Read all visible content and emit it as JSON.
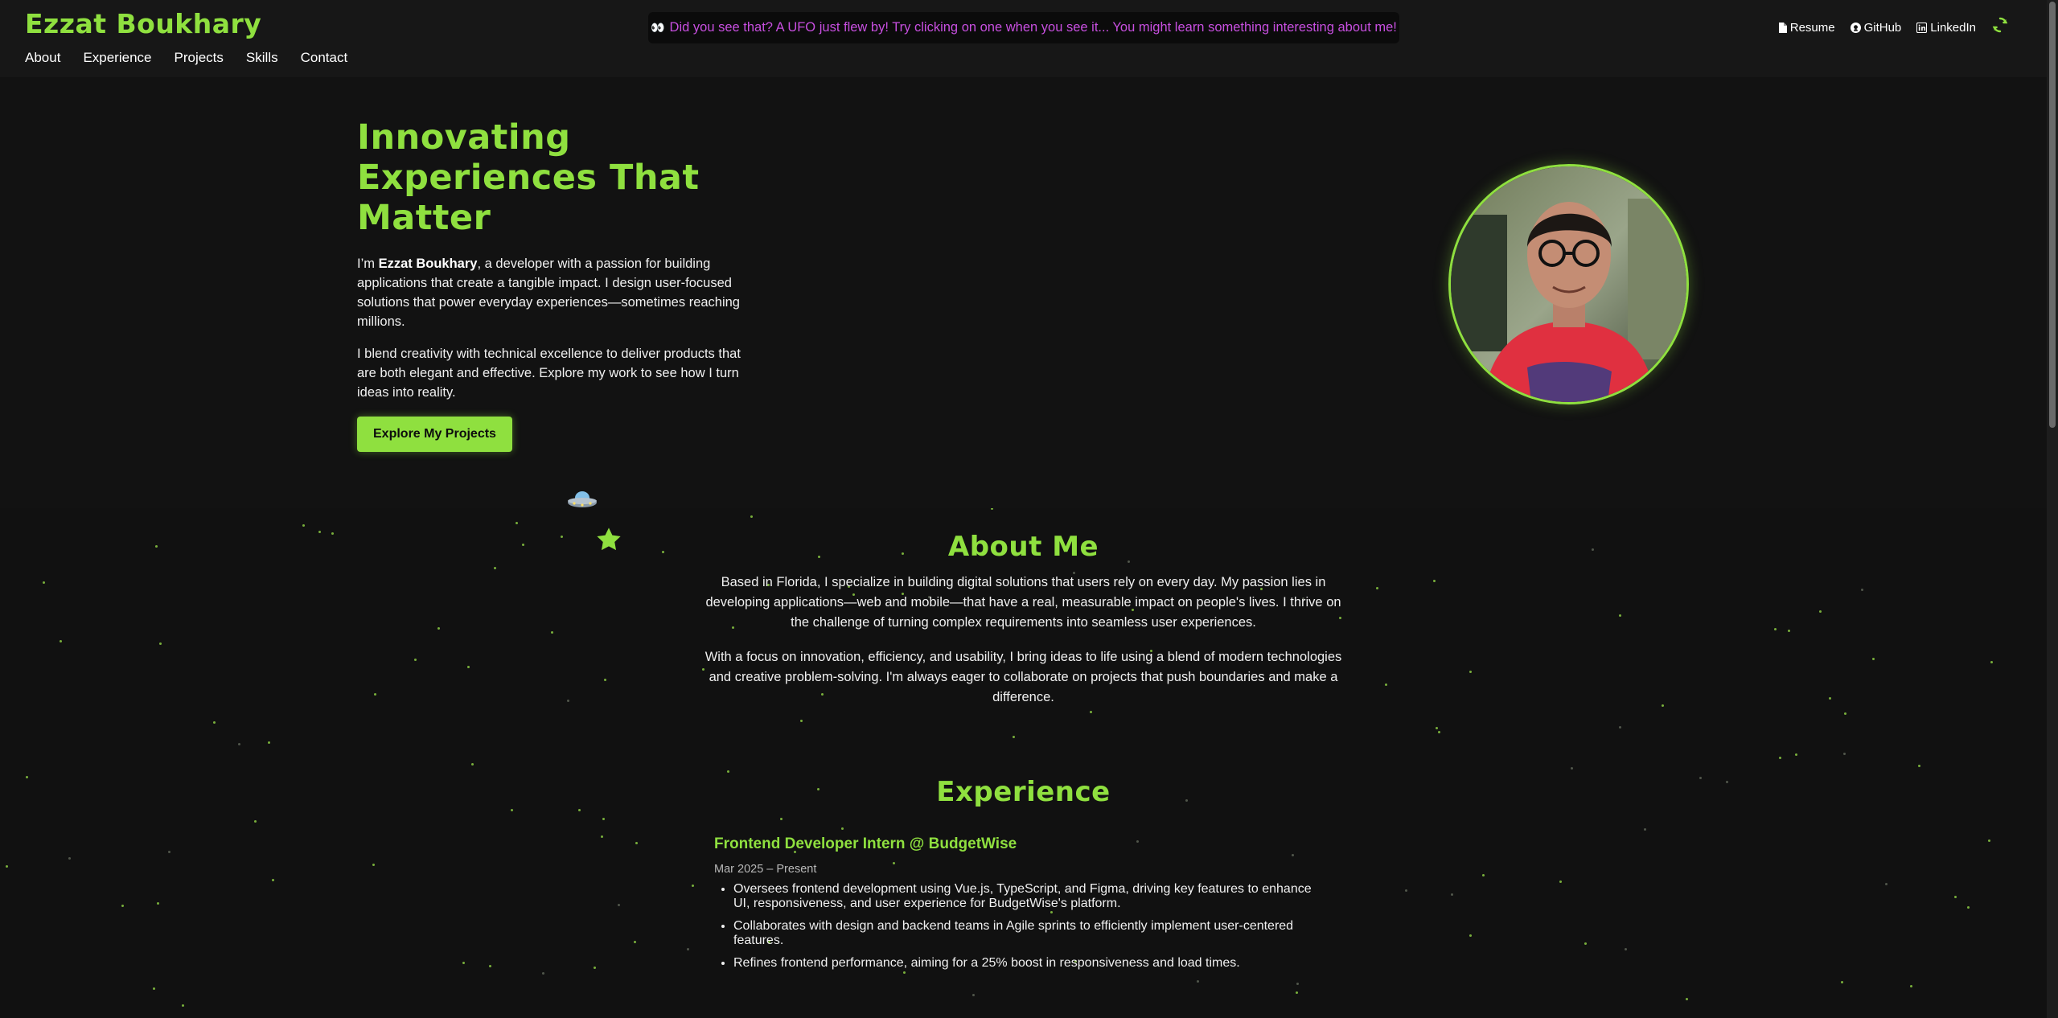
{
  "header": {
    "brand": "Ezzat Boukhary",
    "nav": [
      "About",
      "Experience",
      "Projects",
      "Skills",
      "Contact"
    ],
    "banner_eyes": "👀",
    "banner_text": "Did you see that? A UFO just flew by! Try clicking on one when you see it... You might learn something interesting about me!",
    "links": {
      "resume": "Resume",
      "github": "GitHub",
      "linkedin": "LinkedIn"
    }
  },
  "hero": {
    "title": "Innovating Experiences That Matter",
    "p1_pre": "I’m ",
    "p1_name": "Ezzat Boukhary",
    "p1_post": ", a developer with a passion for building applications that create a tangible impact. I design user-focused solutions that power everyday experiences—sometimes reaching millions.",
    "p2": "I blend creativity with technical excellence to deliver products that are both elegant and effective. Explore my work to see how I turn ideas into reality.",
    "cta": "Explore My Projects"
  },
  "about": {
    "title": "About Me",
    "p1": "Based in Florida, I specialize in building digital solutions that users rely on every day. My passion lies in developing applications—web and mobile—that have a real, measurable impact on people's lives. I thrive on the challenge of turning complex requirements into seamless user experiences.",
    "p2": "With a focus on innovation, efficiency, and usability, I bring ideas to life using a blend of modern technologies and creative problem-solving. I'm always eager to collaborate on projects that push boundaries and make a difference."
  },
  "experience": {
    "title": "Experience",
    "jobs": [
      {
        "title": "Frontend Developer Intern @ BudgetWise",
        "date": "Mar 2025 – Present",
        "bullets": [
          "Oversees frontend development using Vue.js, TypeScript, and Figma, driving key features to enhance UI, responsiveness, and user experience for BudgetWise's platform.",
          "Collaborates with design and backend teams in Agile sprints to efficiently implement user-centered features.",
          "Refines frontend performance, aiming for a 25% boost in responsiveness and load times."
        ]
      }
    ]
  },
  "colors": {
    "accent": "#8fe03f",
    "background": "#111111",
    "banner_text": "#c84fe0"
  },
  "icons": {
    "resume": "file-icon",
    "github": "github-icon",
    "linkedin": "linkedin-icon",
    "theme": "recycle-icon",
    "ufo": "ufo-icon",
    "star": "star-icon"
  }
}
